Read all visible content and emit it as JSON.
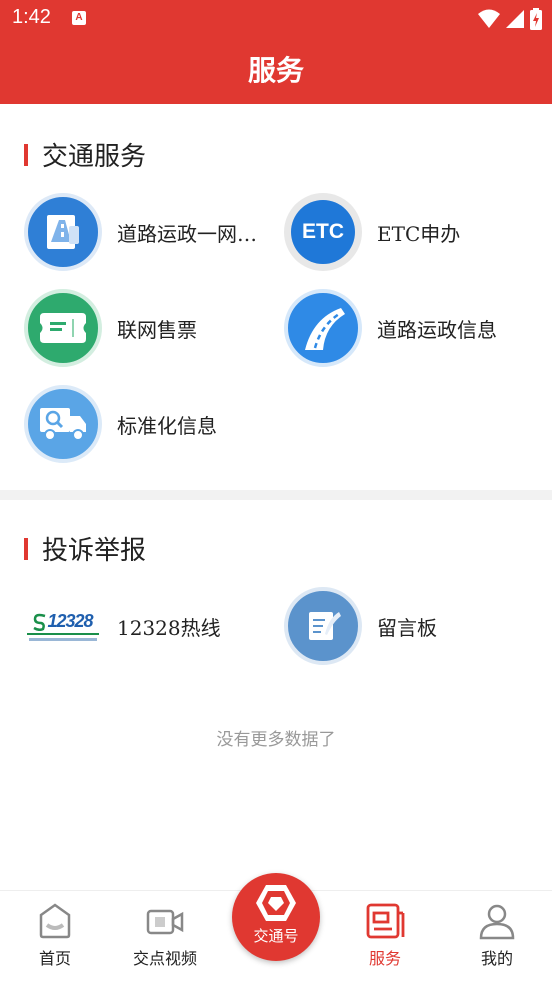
{
  "status": {
    "time": "1:42",
    "notif_letter": "A",
    "icons": [
      "wifi-icon",
      "signal-icon",
      "battery-charging-icon"
    ]
  },
  "header": {
    "title": "服务"
  },
  "traffic": {
    "title": "交通服务",
    "items": [
      {
        "label": "道路运政一网…",
        "icon": "road-document-icon",
        "color": "#2f7fd6"
      },
      {
        "label": "ETC申办",
        "icon": "etc-icon",
        "icon_text": "ETC",
        "color": "#1f78d8"
      },
      {
        "label": "联网售票",
        "icon": "ticket-icon",
        "color": "#2eaa6e"
      },
      {
        "label": "道路运政信息",
        "icon": "road-icon",
        "color": "#2f8ae6"
      },
      {
        "label": "标准化信息",
        "icon": "truck-search-icon",
        "color": "#5aa5e6"
      }
    ]
  },
  "complaint": {
    "title": "投诉举报",
    "items": [
      {
        "label": "12328热线",
        "icon": "hotline-12328-logo",
        "logo_text": "12328"
      },
      {
        "label": "留言板",
        "icon": "message-board-icon",
        "color": "#5b93cc"
      }
    ]
  },
  "footer_text": "没有更多数据了",
  "tabbar": {
    "tabs": [
      {
        "label": "首页",
        "icon": "home-icon"
      },
      {
        "label": "交点视频",
        "icon": "video-icon"
      },
      {
        "label": "交通号",
        "icon": "traffic-logo-icon"
      },
      {
        "label": "服务",
        "icon": "service-icon",
        "active": true
      },
      {
        "label": "我的",
        "icon": "user-icon"
      }
    ]
  },
  "colors": {
    "brand": "#e03831",
    "section_bar": "#e03831",
    "muted": "#999999"
  }
}
